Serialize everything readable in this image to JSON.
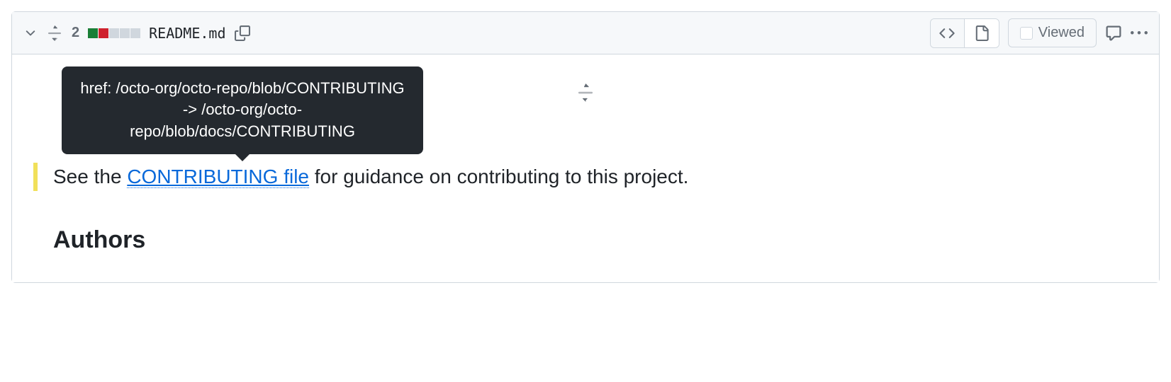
{
  "header": {
    "diff_count": "2",
    "filename": "README.md",
    "viewed_label": "Viewed"
  },
  "body": {
    "line_prefix": "See the ",
    "link_text": "CONTRIBUTING file",
    "line_suffix": " for guidance on contributing to this project.",
    "tooltip_text": "href: /octo-org/octo-repo/blob/CONTRIBUTING -> /octo-org/octo-repo/blob/docs/CONTRIBUTING",
    "heading": "Authors"
  }
}
